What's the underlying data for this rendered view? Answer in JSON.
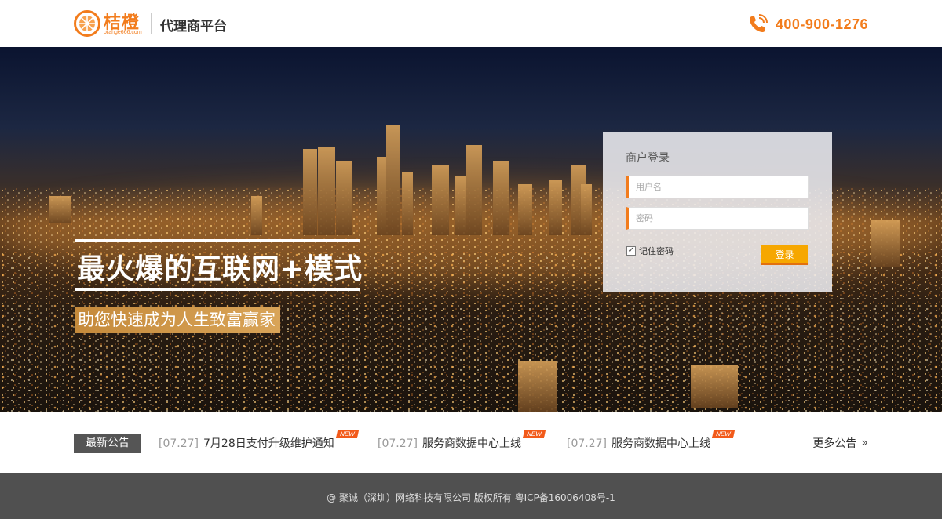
{
  "header": {
    "logo_name": "桔橙",
    "logo_url": "orange666.com",
    "platform_name": "代理商平台",
    "phone": "400-900-1276"
  },
  "hero": {
    "slogan_main": "最火爆的互联网+模式",
    "slogan_sub": "助您快速成为人生致富赢家"
  },
  "login": {
    "title": "商户登录",
    "username_placeholder": "用户名",
    "password_placeholder": "密码",
    "remember_label": "记住密码",
    "remember_checked": true,
    "submit_label": "登录"
  },
  "notices": {
    "label": "最新公告",
    "items": [
      {
        "date": "[07.27]",
        "title": "7月28日支付升级维护通知",
        "badge": "NEW"
      },
      {
        "date": "[07.27]",
        "title": "服务商数据中心上线",
        "badge": "NEW"
      },
      {
        "date": "[07.27]",
        "title": "服务商数据中心上线",
        "badge": "NEW"
      }
    ],
    "more_label": "更多公告"
  },
  "footer": {
    "copyright": "@ 聚诚（深圳）网络科技有限公司  版权所有  粤ICP备16006408号-1"
  },
  "colors": {
    "brand_orange": "#f27c1c",
    "button_yellow": "#f6a700",
    "footer_bg": "#505050",
    "notice_label_bg": "#555555",
    "new_badge": "#f25a1a"
  }
}
